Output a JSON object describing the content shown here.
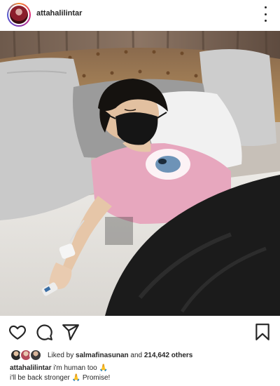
{
  "post": {
    "username": "attahalilintar",
    "likes": {
      "prefix": "Liked by",
      "liker": "salmafinasunan",
      "conjunction": "and",
      "count": "214,642 others"
    },
    "caption": {
      "username": "attahalilintar",
      "line1": "i'm human too 🙏",
      "line2": "i'll be back stronger 🙏 Promise!"
    }
  },
  "icons": {
    "more": "more-options-icon",
    "like": "heart-icon",
    "comment": "comment-icon",
    "share": "share-icon",
    "save": "bookmark-icon"
  },
  "colors": {
    "text": "#262626",
    "pillow": "#cfcfcf",
    "headboard": "#b7874f",
    "shirt": "#e7a7be",
    "blanket": "#1b1b1b"
  }
}
